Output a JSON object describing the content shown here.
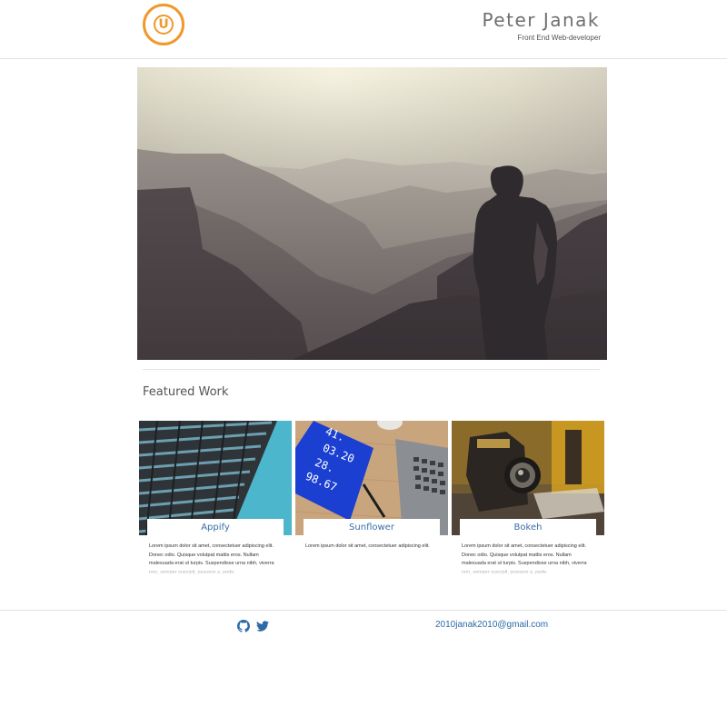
{
  "header": {
    "logo_letter": "U",
    "name": "Peter Janak",
    "role": "Front End Web-developer"
  },
  "hero": {
    "description_alt": "hero-photo"
  },
  "featured": {
    "title": "Featured Work",
    "cards": [
      {
        "title": "Appify",
        "text": "Lorem ipsum dolor sit amet, consectetuer adipiscing elit. Donec odio. Quisque volutpat mattis eros. Nullam malesuada erat ut turpis. Suspendisse urna nibh, viverra non, semper suscipit, posuere a, pede."
      },
      {
        "title": "Sunflower",
        "text": "Lorem ipsum dolor sit amet, consectetuer adipiscing elit."
      },
      {
        "title": "Bokeh",
        "text": "Lorem ipsum dolor sit amet, consectetuer adipiscing elit. Donec odio. Quisque volutpat mattis eros. Nullam malesuada erat ut turpis. Suspendisse urna nibh, viverra non, semper suscipit, posuere a, pede."
      }
    ]
  },
  "footer": {
    "icons": [
      "github-icon",
      "twitter-icon"
    ],
    "email": "2010janak2010@gmail.com"
  },
  "colors": {
    "accent": "#f0982a",
    "link": "#2d6aa6",
    "card_title": "#3a6ea5"
  }
}
